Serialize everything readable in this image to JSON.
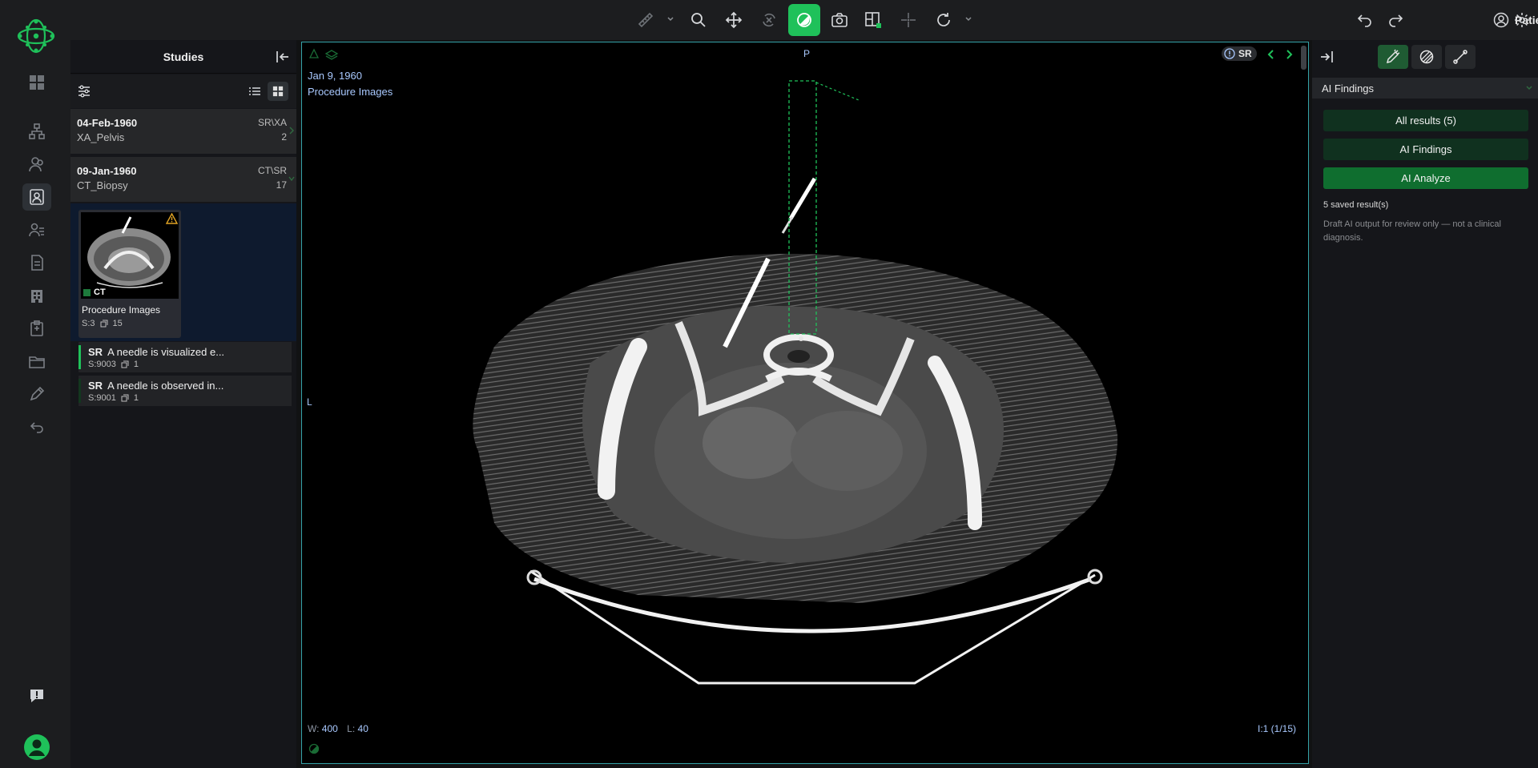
{
  "colors": {
    "accent": "#1fc15a",
    "viewport_border": "#35a2a8",
    "overlay_text": "#a9c9ff",
    "panel_bg": "#15161a"
  },
  "rail": {
    "icons": [
      "logo-icon",
      "dashboard-icon",
      "hierarchy-icon",
      "patients-icon",
      "study-viewer-icon",
      "users-icon",
      "document-icon",
      "hospital-icon",
      "clipboard-icon",
      "folder-icon",
      "pencil-icon",
      "return-icon",
      "feedback-icon",
      "profile-icon"
    ]
  },
  "toolbar": {
    "tools": [
      "ruler-icon",
      "zoom-icon",
      "pan-icon",
      "rotate-3d-icon",
      "window-level-icon",
      "camera-icon",
      "layout-icon",
      "crosshair-icon",
      "reset-icon"
    ],
    "active_tool": "window-level-icon",
    "patient_label": "Patient"
  },
  "studies_panel": {
    "title": "Studies",
    "studies": [
      {
        "date": "04-Feb-1960",
        "name": "XA_Pelvis",
        "modalities": "SR\\XA",
        "count": "2"
      },
      {
        "date": "09-Jan-1960",
        "name": "CT_Biopsy",
        "modalities": "CT\\SR",
        "count": "17"
      }
    ],
    "series": {
      "modality": "CT",
      "description": "Procedure Images",
      "series_number": "S:3",
      "instances": "15"
    },
    "sr_items": [
      {
        "tag": "SR",
        "text": "A needle is visualized e...",
        "series_number": "S:9003",
        "instances": "1",
        "active": true
      },
      {
        "tag": "SR",
        "text": "A needle is observed in...",
        "series_number": "S:9001",
        "instances": "1",
        "active": false
      }
    ]
  },
  "viewport": {
    "date": "Jan 9, 1960",
    "series_description": "Procedure Images",
    "orientation_top": "P",
    "orientation_left": "L",
    "window_label": "W:",
    "window_value": "400",
    "level_label": "L:",
    "level_value": "40",
    "image_index": "I:1 (1/15)",
    "sr_badge": "SR"
  },
  "right_panel": {
    "section_title": "AI Findings",
    "buttons": [
      "All results (5)",
      "AI Findings",
      "AI Analyze"
    ],
    "saved_results": "5 saved result(s)",
    "disclaimer": "Draft AI output for review only — not a clinical diagnosis."
  }
}
